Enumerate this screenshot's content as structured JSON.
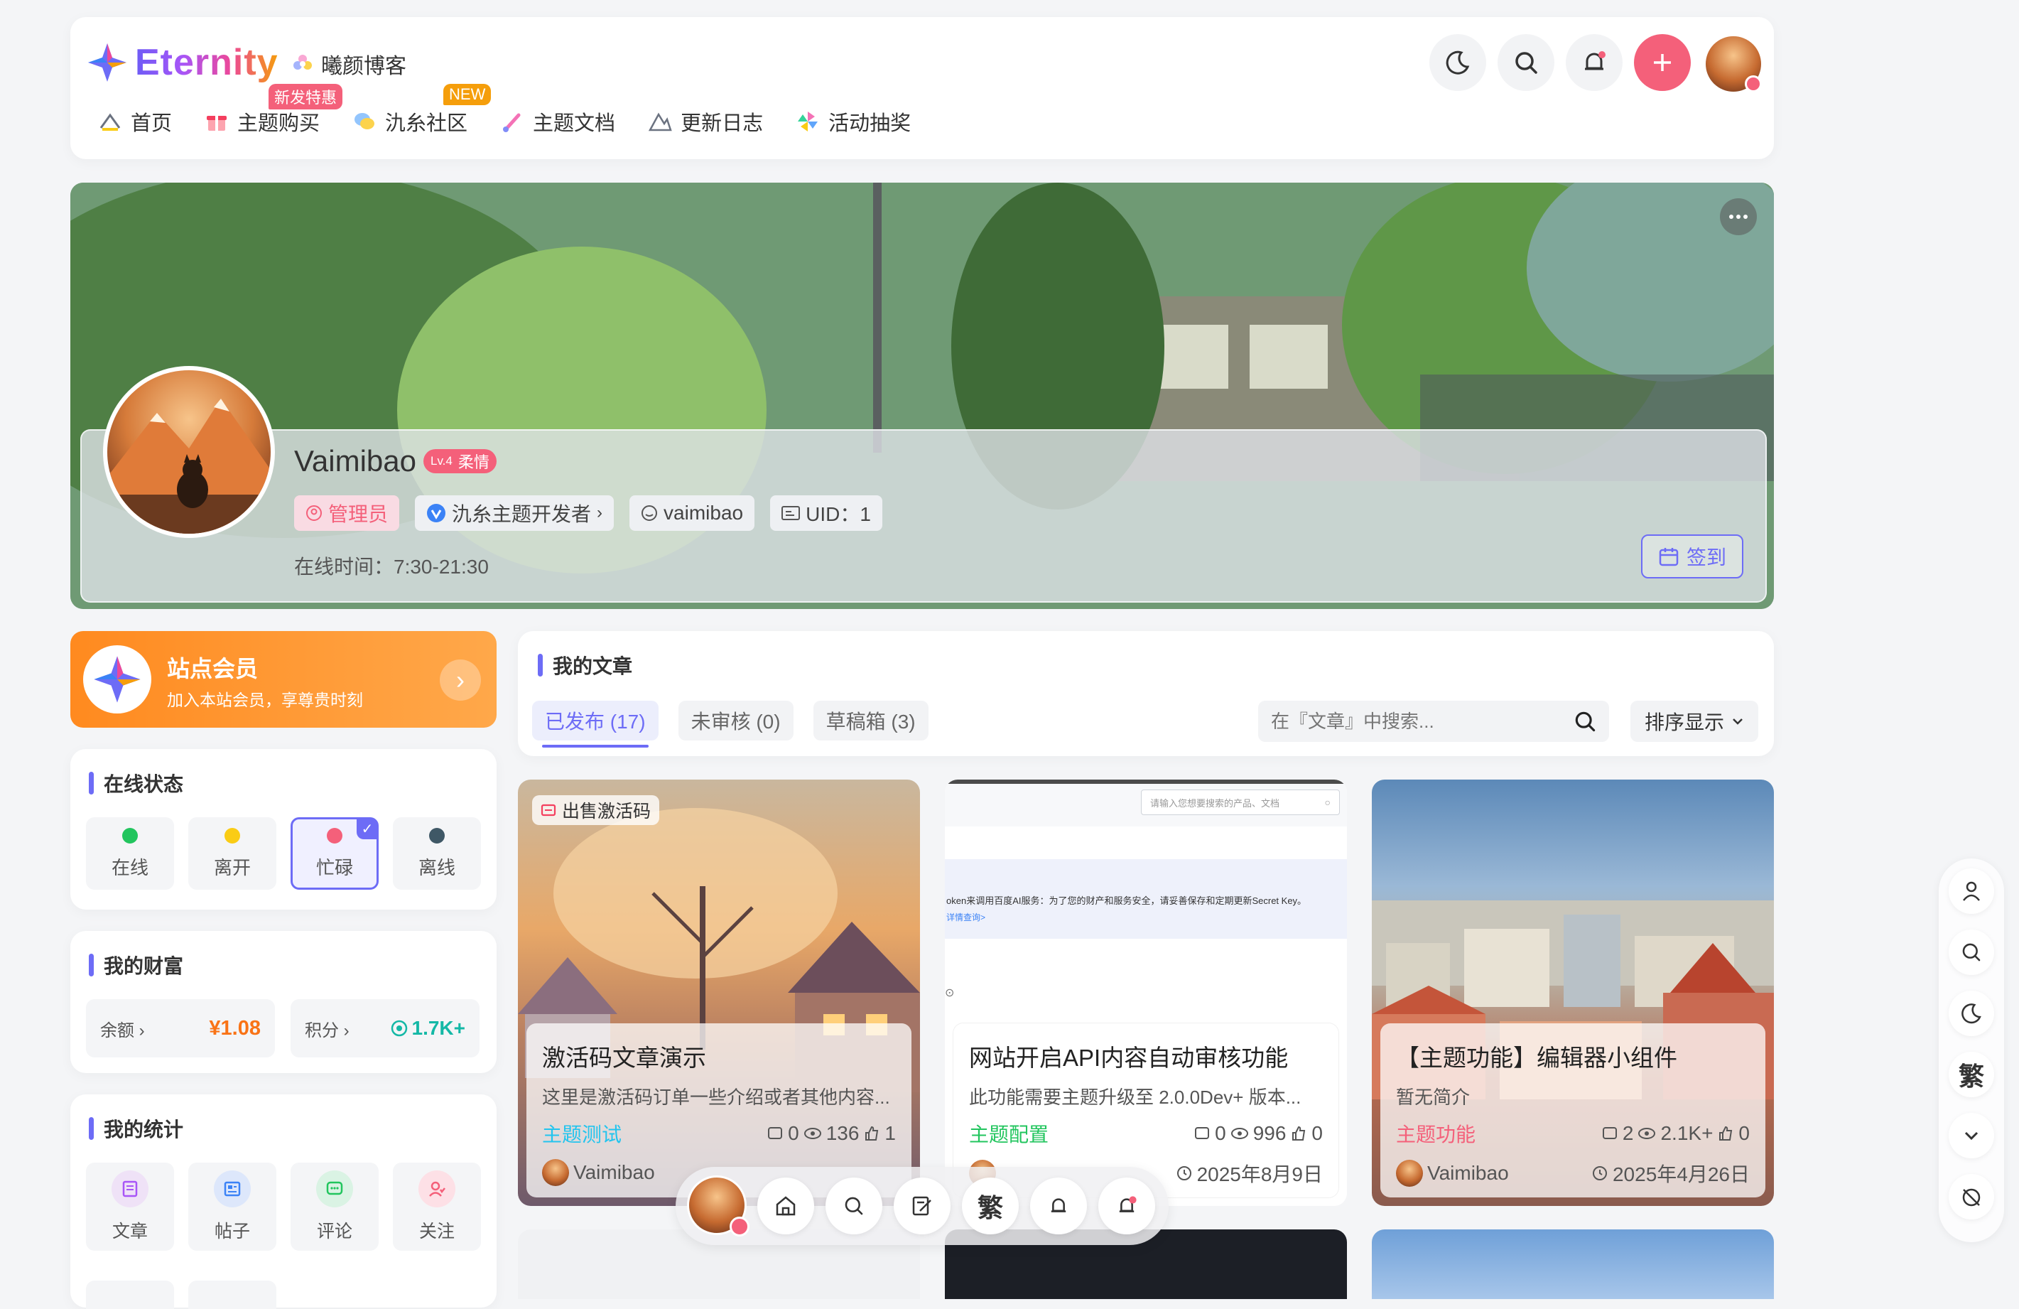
{
  "header": {
    "logo_text": "Eternity",
    "site_name": "曦颜博客",
    "nav": [
      {
        "label": "首页",
        "icon": "home-icon"
      },
      {
        "label": "主题购买",
        "icon": "gift-icon",
        "badge": "新发特惠"
      },
      {
        "label": "氿糸社区",
        "icon": "chat-icon",
        "badge": "NEW"
      },
      {
        "label": "主题文档",
        "icon": "brush-icon"
      },
      {
        "label": "更新日志",
        "icon": "mountain-icon"
      },
      {
        "label": "活动抽奖",
        "icon": "pinwheel-icon"
      }
    ],
    "colors": {
      "plus_button": "#f4607a",
      "accent": "#6d6cf6"
    }
  },
  "profile": {
    "name": "Vaimibao",
    "level": "Lv.4",
    "level_title": "柔情",
    "role": "管理员",
    "verified": "氿糸主题开发者",
    "username": "vaimibao",
    "uid": "UID：1",
    "online_time": "在线时间：7:30-21:30",
    "signin": "签到"
  },
  "membership": {
    "title": "站点会员",
    "subtitle": "加入本站会员，享尊贵时刻"
  },
  "online_status": {
    "title": "在线状态",
    "items": [
      {
        "label": "在线",
        "color": "#22c55e"
      },
      {
        "label": "离开",
        "color": "#facc15"
      },
      {
        "label": "忙碌",
        "color": "#f4607a",
        "selected": true
      },
      {
        "label": "离线",
        "color": "#3f5866"
      }
    ]
  },
  "wealth": {
    "title": "我的财富",
    "balance_label": "余额",
    "balance_value": "¥1.08",
    "points_label": "积分",
    "points_value": "1.7K+"
  },
  "stats": {
    "title": "我的统计",
    "items": [
      {
        "label": "文章",
        "icon": "article-icon"
      },
      {
        "label": "帖子",
        "icon": "post-icon"
      },
      {
        "label": "评论",
        "icon": "comment-icon"
      },
      {
        "label": "关注",
        "icon": "follow-icon"
      }
    ]
  },
  "articles_panel": {
    "title": "我的文章",
    "tabs": [
      {
        "label": "已发布 (17)",
        "active": true
      },
      {
        "label": "未审核 (0)"
      },
      {
        "label": "草稿箱 (3)"
      }
    ],
    "search_placeholder": "在『文章』中搜索...",
    "sort_label": "排序显示"
  },
  "articles": [
    {
      "badge": "出售激活码",
      "title": "激活码文章演示",
      "desc": "这里是激活码订单一些介绍或者其他内容...",
      "category": "主题测试",
      "category_color": "#22c4ee",
      "comments": "0",
      "views": "136",
      "likes": "1",
      "author": "Vaimibao",
      "date": ""
    },
    {
      "title": "网站开启API内容自动审核功能",
      "desc": "此功能需要主题升级至 2.0.0Dev+ 版本...",
      "category": "主题配置",
      "category_color": "#22c55e",
      "comments": "0",
      "views": "996",
      "likes": "0",
      "author": "",
      "date": "2025年8月9日",
      "screenshot_search": "请输入您想要搜索的产品、文档",
      "screenshot_text": "oken来调用百度AI服务：为了您的财产和服务安全，请妥善保存和定期更新Secret Key。",
      "screenshot_link": "详情查询>"
    },
    {
      "title": "【主题功能】编辑器小组件",
      "desc": "暂无简介",
      "category": "主题功能",
      "category_color": "#f4607a",
      "comments": "2",
      "views": "2.1K+",
      "likes": "0",
      "author": "Vaimibao",
      "date": "2025年4月26日"
    }
  ],
  "side_tools": [
    "user-icon",
    "search-icon",
    "moon-icon",
    "繁",
    "chevron-down-icon",
    "alarm-icon"
  ],
  "side_traditional": "繁",
  "bottom_bar": {
    "traditional": "繁"
  }
}
